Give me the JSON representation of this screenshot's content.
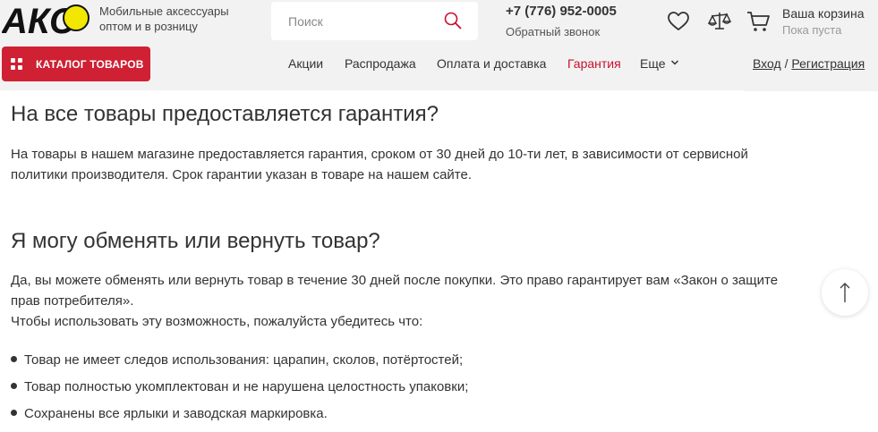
{
  "header": {
    "logo_text": "АКС",
    "tagline": [
      "Мобильные аксессуары",
      "оптом и в розницу"
    ],
    "search": {
      "placeholder": "Поиск",
      "value": ""
    },
    "phone": "+7 (776) 952-0005",
    "callback": "Обратный звонок",
    "cart": {
      "title": "Ваша корзина",
      "status": "Пока пуста"
    }
  },
  "nav": {
    "catalog_label": "КАТАЛОГ ТОВАРОВ",
    "items": [
      "Акции",
      "Распродажа",
      "Оплата и доставка",
      "Гарантия"
    ],
    "active_item": "Гарантия",
    "more_label": "Еще",
    "login_label": "Вход",
    "separator": "/",
    "register_label": "Регистрация"
  },
  "content": {
    "warranty_heading": "На все товары предоставляется гарантия?",
    "warranty_text": [
      "На товары в нашем магазине предоставляется гарантия, сроком от 30 дней до 10-ти лет, в зависимости от сервисной",
      "политики производителя. Срок гарантии указан в товаре на нашем сайте."
    ],
    "return_heading": "Я могу обменять или вернуть товар?",
    "return_text": [
      "Да, вы можете обменять или вернуть товар в течение 30 дней после покупки. Это право гарантирует вам «Закон о защите",
      "прав потребителя».",
      "Чтобы использовать эту возможность, пожалуйста убедитесь что:"
    ],
    "conditions": [
      "Товар не имеет следов использования: царапин, сколов, потёртостей;",
      "Товар полностью укомплектован и не нарушена целостность упаковки;",
      "Сохранены все ярлыки и заводская маркировка."
    ]
  },
  "colors": {
    "accent": "#cf2133",
    "active_nav": "#c8102e",
    "logo_yellow": "#f2e700"
  },
  "icons": {
    "search": "search-icon",
    "favorites": "heart-icon",
    "compare": "scales-icon",
    "cart": "cart-icon",
    "scroll_top": "arrow-up-icon"
  }
}
